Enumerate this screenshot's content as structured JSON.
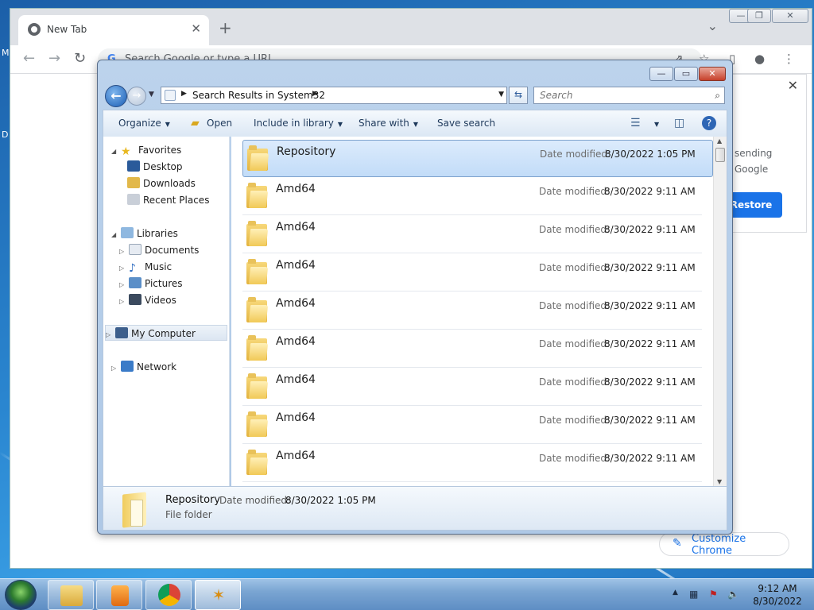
{
  "chrome": {
    "tab_title": "New Tab",
    "tab_close": "✕",
    "new_tab": "+",
    "tab_menu": "⌄",
    "omnibox_placeholder": "Search Google or type a URL",
    "popup_line1": "sending",
    "popup_line2": "Google",
    "restore_label": "Restore",
    "customize_label": "Customize Chrome",
    "win_controls": [
      "—",
      "❐",
      "✕"
    ]
  },
  "explorer": {
    "controls": [
      "—",
      "▭",
      "✕"
    ],
    "address": {
      "path": "Search Results in System32"
    },
    "search_placeholder": "Search",
    "commands": {
      "organize": "Organize",
      "open": "Open",
      "include": "Include in library",
      "share": "Share with",
      "save_search": "Save search"
    },
    "nav": {
      "favorites": "Favorites",
      "desktop": "Desktop",
      "downloads": "Downloads",
      "recent": "Recent Places",
      "libraries": "Libraries",
      "documents": "Documents",
      "music": "Music",
      "pictures": "Pictures",
      "videos": "Videos",
      "computer": "My Computer",
      "network": "Network"
    },
    "date_label": "Date modified:",
    "files": [
      {
        "name": "Repository",
        "date": "8/30/2022 1:05 PM"
      },
      {
        "name": "Amd64",
        "date": "8/30/2022 9:11 AM"
      },
      {
        "name": "Amd64",
        "date": "8/30/2022 9:11 AM"
      },
      {
        "name": "Amd64",
        "date": "8/30/2022 9:11 AM"
      },
      {
        "name": "Amd64",
        "date": "8/30/2022 9:11 AM"
      },
      {
        "name": "Amd64",
        "date": "8/30/2022 9:11 AM"
      },
      {
        "name": "Amd64",
        "date": "8/30/2022 9:11 AM"
      },
      {
        "name": "Amd64",
        "date": "8/30/2022 9:11 AM"
      },
      {
        "name": "Amd64",
        "date": "8/30/2022 9:11 AM"
      }
    ],
    "details": {
      "name": "Repository",
      "date_label": "Date modified:",
      "date": "8/30/2022 1:05 PM",
      "type": "File folder"
    }
  },
  "taskbar": {
    "time": "9:12 AM",
    "date": "8/30/2022"
  },
  "desktop_letters": [
    "M",
    "D"
  ]
}
